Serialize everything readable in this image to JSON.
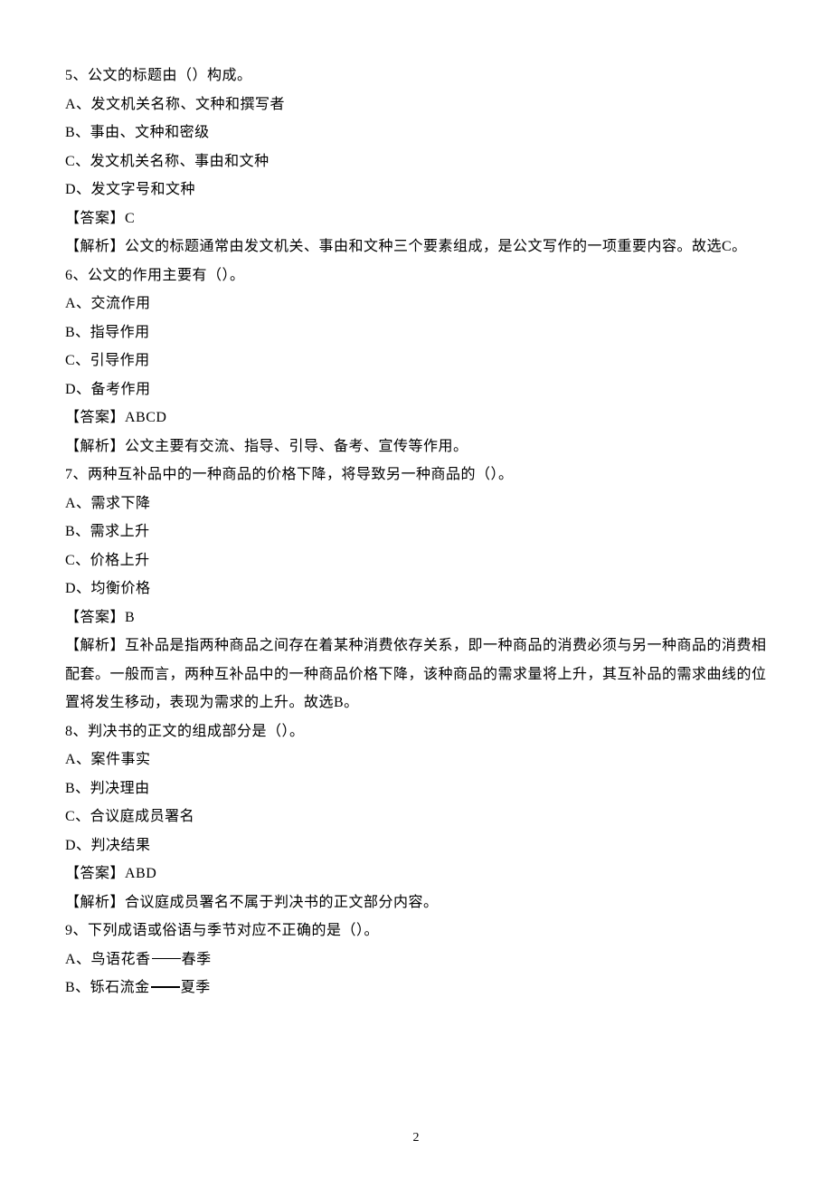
{
  "questions": [
    {
      "num": "5、公文的标题由（）构成。",
      "opts": [
        "A、发文机关名称、文种和撰写者",
        "B、事由、文种和密级",
        "C、发文机关名称、事由和文种",
        "D、发文字号和文种"
      ],
      "ans": "【答案】C",
      "expl": "【解析】公文的标题通常由发文机关、事由和文种三个要素组成，是公文写作的一项重要内容。故选C。"
    },
    {
      "num": "6、公文的作用主要有（）。",
      "opts": [
        "A、交流作用",
        "B、指导作用",
        "C、引导作用",
        "D、备考作用"
      ],
      "ans": "【答案】ABCD",
      "expl": "【解析】公文主要有交流、指导、引导、备考、宣传等作用。"
    },
    {
      "num": "7、两种互补品中的一种商品的价格下降，将导致另一种商品的（）。",
      "opts": [
        "A、需求下降",
        "B、需求上升",
        "C、价格上升",
        "D、均衡价格"
      ],
      "ans": "【答案】B",
      "expl": "【解析】互补品是指两种商品之间存在着某种消费依存关系，即一种商品的消费必须与另一种商品的消费相配套。一般而言，两种互补品中的一种商品价格下降，该种商品的需求量将上升，其互补品的需求曲线的位置将发生移动，表现为需求的上升。故选B。"
    },
    {
      "num": "8、判决书的正文的组成部分是（）。",
      "opts": [
        "A、案件事实",
        "B、判决理由",
        "C、合议庭成员署名",
        "D、判决结果"
      ],
      "ans": "【答案】ABD",
      "expl": "【解析】合议庭成员署名不属于判决书的正文部分内容。"
    },
    {
      "num": "9、下列成语或俗语与季节对应不正确的是（）。",
      "opts": [
        {
          "pre": "A、鸟语花香",
          "post": "春季"
        },
        {
          "pre": "B、铄石流金",
          "post": "夏季"
        }
      ]
    }
  ],
  "pageNumber": "2"
}
